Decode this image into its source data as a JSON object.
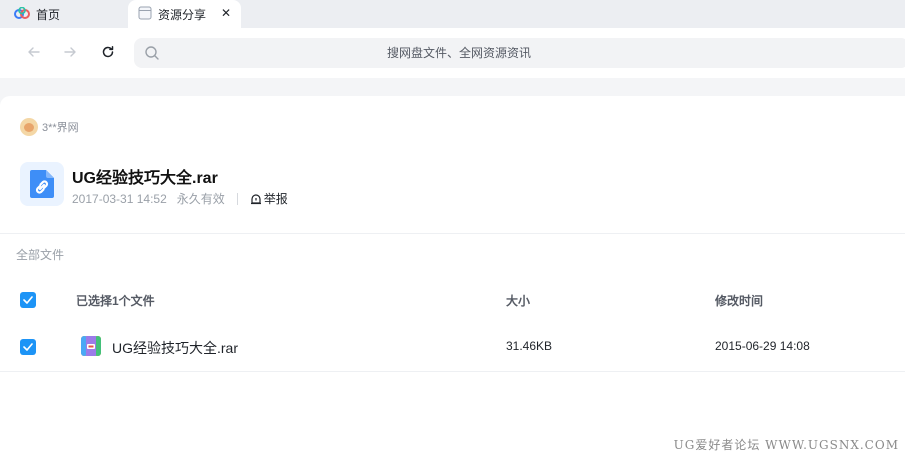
{
  "tabs": {
    "home_label": "首页",
    "active_label": "资源分享",
    "close_glyph": "✕"
  },
  "toolbar": {
    "search_placeholder": "搜网盘文件、全网资源资讯"
  },
  "share": {
    "sharer_name": "3**界网",
    "file_title": "UG经验技巧大全.rar",
    "share_time": "2017-03-31 14:52",
    "validity": "永久有效",
    "report_label": "举报"
  },
  "file_list": {
    "section_label": "全部文件",
    "selected_label": "已选择1个文件",
    "col_size": "大小",
    "col_modified": "修改时间",
    "rows": [
      {
        "name": "UG经验技巧大全.rar",
        "size": "31.46KB",
        "modified": "2015-06-29 14:08"
      }
    ]
  },
  "watermark": "UG爱好者论坛 WWW.UGSNX.COM",
  "colors": {
    "accent": "#1d94f6",
    "tab_bar": "#eceef2",
    "page_bg": "#f4f5f7"
  },
  "icons": [
    "baidu-netdisk-logo-icon",
    "tab-page-icon",
    "close-icon",
    "back-arrow-icon",
    "forward-arrow-icon",
    "reload-icon",
    "search-icon",
    "link-file-icon",
    "report-icon",
    "checkbox-checked-icon",
    "rar-archive-icon"
  ]
}
